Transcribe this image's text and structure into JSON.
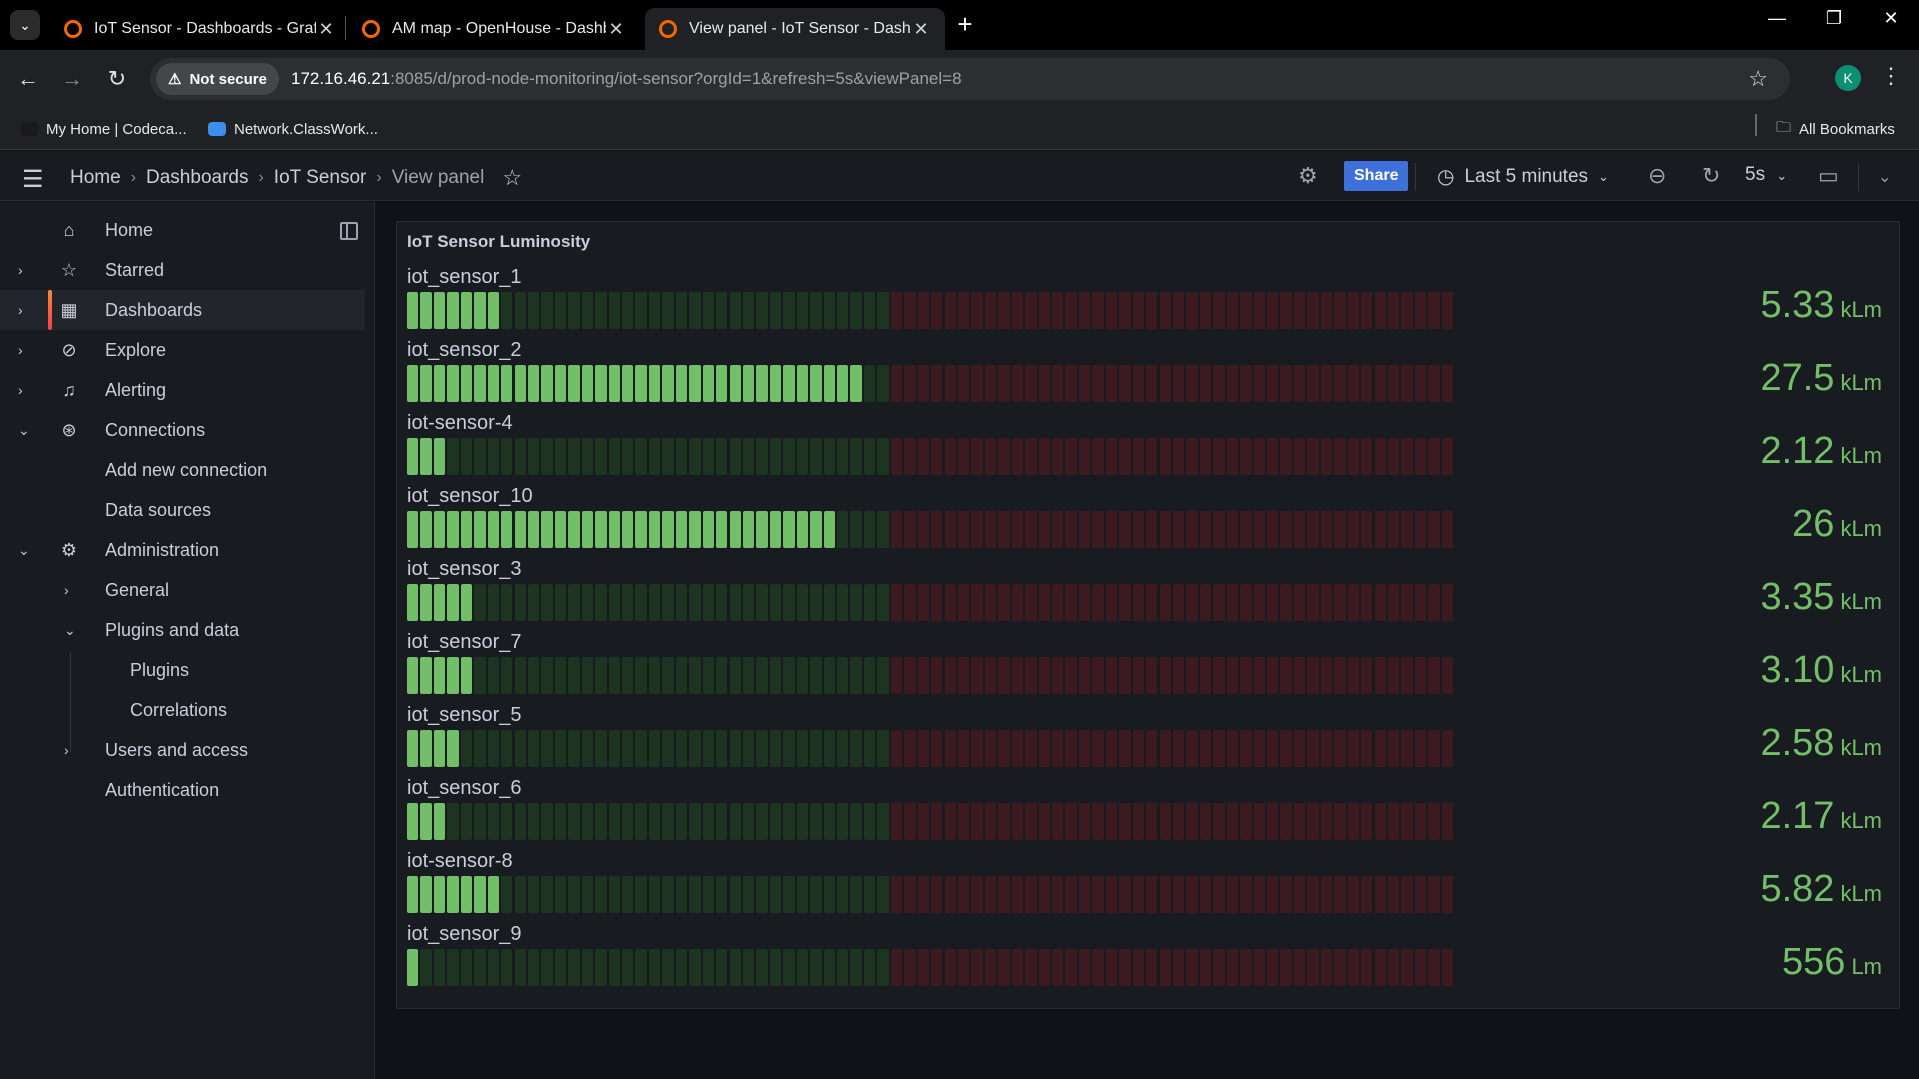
{
  "browser": {
    "tabs": [
      {
        "title": "IoT Sensor - Dashboards - Grafana",
        "icon": "grafana-icon"
      },
      {
        "title": "AM map - OpenHouse - Dashboards",
        "icon": "grafana-icon"
      },
      {
        "title": "View panel - IoT Sensor - Dashboards",
        "icon": "grafana-icon"
      }
    ],
    "security_label": "Not secure",
    "url_host": "172.16.46.21",
    "url_rest": ":8085/d/prod-node-monitoring/iot-sensor?orgId=1&refresh=5s&viewPanel=8",
    "profile_initial": "K",
    "bookmarks": [
      "My Home | Codeca...",
      "Network.ClassWork..."
    ],
    "all_bookmarks": "All Bookmarks"
  },
  "topnav": {
    "breadcrumbs": [
      "Home",
      "Dashboards",
      "IoT Sensor",
      "View panel"
    ],
    "share_label": "Share",
    "time_range": "Last 5 minutes",
    "refresh_interval": "5s"
  },
  "sidebar": {
    "items": [
      {
        "label": "Home",
        "icon": "home-icon"
      },
      {
        "label": "Starred",
        "icon": "star-icon"
      },
      {
        "label": "Dashboards",
        "icon": "apps-icon"
      },
      {
        "label": "Explore",
        "icon": "compass-icon"
      },
      {
        "label": "Alerting",
        "icon": "bell-icon"
      },
      {
        "label": "Connections",
        "icon": "connections-icon"
      },
      {
        "label": "Add new connection"
      },
      {
        "label": "Data sources"
      },
      {
        "label": "Administration",
        "icon": "cog-icon"
      },
      {
        "label": "General"
      },
      {
        "label": "Plugins and data"
      },
      {
        "label": "Plugins"
      },
      {
        "label": "Correlations"
      },
      {
        "label": "Users and access"
      },
      {
        "label": "Authentication"
      }
    ]
  },
  "panel": {
    "title": "IoT Sensor Luminosity",
    "gauge_cells": 78,
    "threshold_fraction": 0.5,
    "colors": {
      "green_on": "#73bf69",
      "green_off": "#1d3520",
      "red_off": "#3d1a1f",
      "value": "#73bf69"
    },
    "rows": [
      {
        "name": "iot_sensor_1",
        "value": "5.33",
        "unit": "kLm",
        "fill": 0.093
      },
      {
        "name": "iot_sensor_2",
        "value": "27.5",
        "unit": "kLm",
        "fill": 0.43
      },
      {
        "name": "iot-sensor-4",
        "value": "2.12",
        "unit": "kLm",
        "fill": 0.035
      },
      {
        "name": "iot_sensor_10",
        "value": "26",
        "unit": "kLm",
        "fill": 0.41
      },
      {
        "name": "iot_sensor_3",
        "value": "3.35",
        "unit": "kLm",
        "fill": 0.058
      },
      {
        "name": "iot_sensor_7",
        "value": "3.10",
        "unit": "kLm",
        "fill": 0.058
      },
      {
        "name": "iot_sensor_5",
        "value": "2.58",
        "unit": "kLm",
        "fill": 0.047
      },
      {
        "name": "iot_sensor_6",
        "value": "2.17",
        "unit": "kLm",
        "fill": 0.035
      },
      {
        "name": "iot-sensor-8",
        "value": "5.82",
        "unit": "kLm",
        "fill": 0.093
      },
      {
        "name": "iot_sensor_9",
        "value": "556",
        "unit": "Lm",
        "fill": 0.012
      }
    ]
  }
}
